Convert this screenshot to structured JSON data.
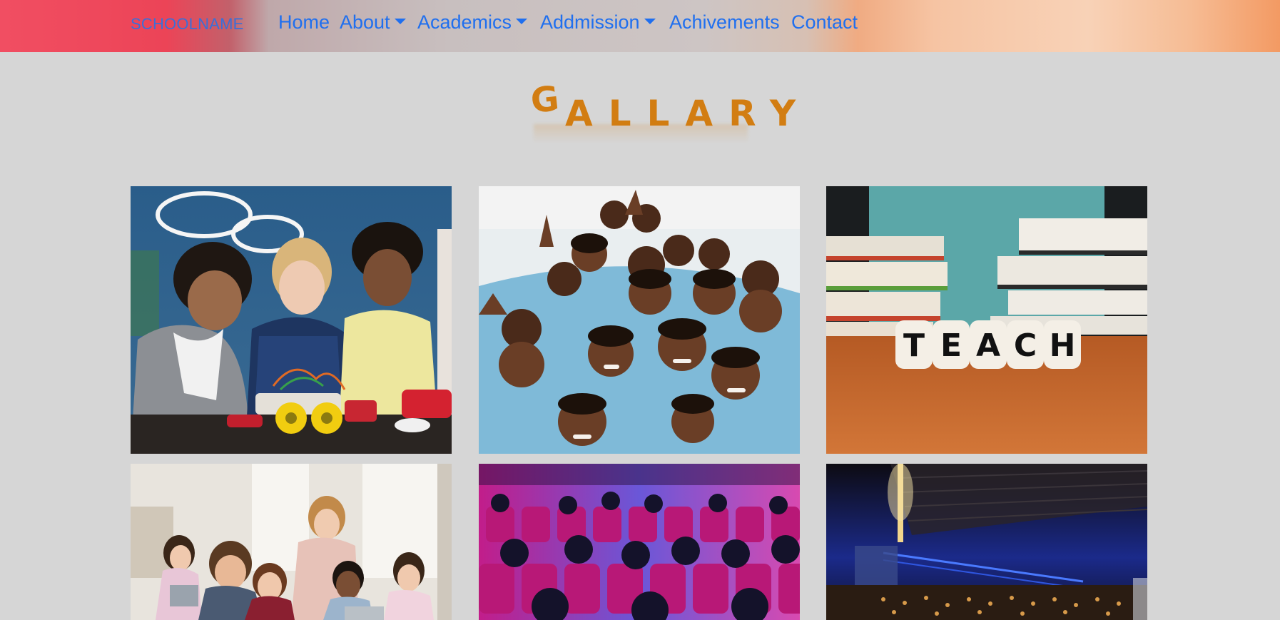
{
  "nav": {
    "brand": "SCHOOLNAME",
    "items": [
      {
        "label": "Home",
        "dropdown": false
      },
      {
        "label": "About",
        "dropdown": true
      },
      {
        "label": "Academics",
        "dropdown": true
      },
      {
        "label": "Addmission",
        "dropdown": true
      },
      {
        "label": "Achivements",
        "dropdown": false
      },
      {
        "label": "Contact",
        "dropdown": false
      }
    ]
  },
  "gallery": {
    "title_first": "G",
    "title_rest": "ALLARY",
    "photos": [
      {
        "subject": "kids building robot car"
      },
      {
        "subject": "smiling students in uniform waving"
      },
      {
        "subject": "TEACH letter dice with books",
        "text": "TEACH"
      },
      {
        "subject": "teacher helping students with laptops"
      },
      {
        "subject": "audience in theater with stage lights"
      },
      {
        "subject": "large auditorium with blue stage lighting"
      }
    ]
  },
  "colors": {
    "page_bg": "#d6d6d6",
    "nav_link": "#1f6fef",
    "brand": "#3a6fd8",
    "title": "#d27d12"
  }
}
